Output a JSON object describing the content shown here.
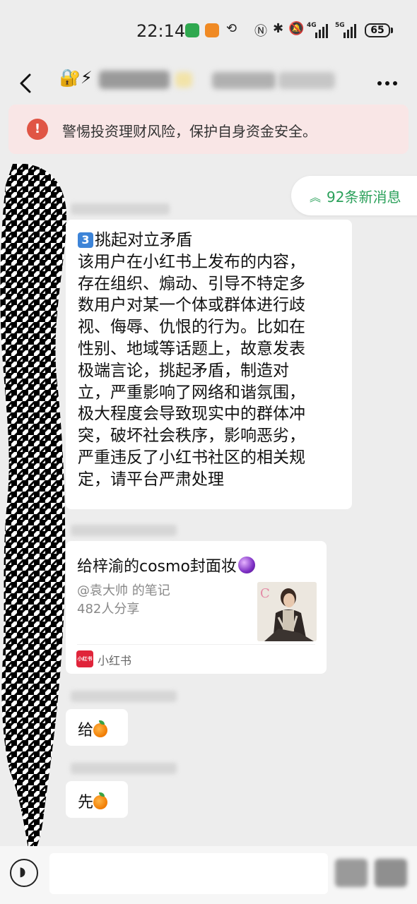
{
  "status_bar": {
    "time": "22:14",
    "network_label": "4G",
    "network_label_2": "5G",
    "battery": "65"
  },
  "nav": {
    "title": "🔐⚡"
  },
  "warning": {
    "icon": "!",
    "text": "警惕投资理财风险，保护自身资金安全。"
  },
  "new_messages": {
    "icon": "︽",
    "label": "92条新消息"
  },
  "messages": {
    "report": {
      "badge": "3",
      "title": "挑起对立矛盾",
      "lines": [
        "该用户在小红书上发布的内容，",
        "存在组织、煽动、引导不特定多",
        "数用户对某一个体或群体进行歧",
        "视、侮辱、仇恨的行为。比如在",
        "性别、地域等话题上，故意发表",
        "极端言论，挑起矛盾，制造对",
        "立，严重影响了网络和谐氛围，",
        "极大程度会导致现实中的群体冲",
        "突，破坏社会秩序，影响恶劣，",
        "严重违反了小红书社区的相关规",
        "定，请平台严肃处理"
      ]
    },
    "card": {
      "title": "给梓渝的cosmo封面妆",
      "author": "@袁大帅 的笔记",
      "shares": "482人分享",
      "source_logo": "小红书",
      "source": "小红书"
    },
    "msg1": {
      "text": "给"
    },
    "msg2": {
      "text": "先"
    }
  },
  "colors": {
    "background": "#ededed",
    "accent_green": "#2aa05a",
    "warning_bg": "#f9e6e6",
    "warning_icon": "#e05545",
    "xhs_red": "#e0243a"
  },
  "icons": {
    "back": "chevron-left-icon",
    "more": "more-dots-icon",
    "voice": "voice-icon",
    "emoji_orange": "orange-emoji-icon",
    "emoji_crystal": "crystal-ball-emoji-icon"
  }
}
